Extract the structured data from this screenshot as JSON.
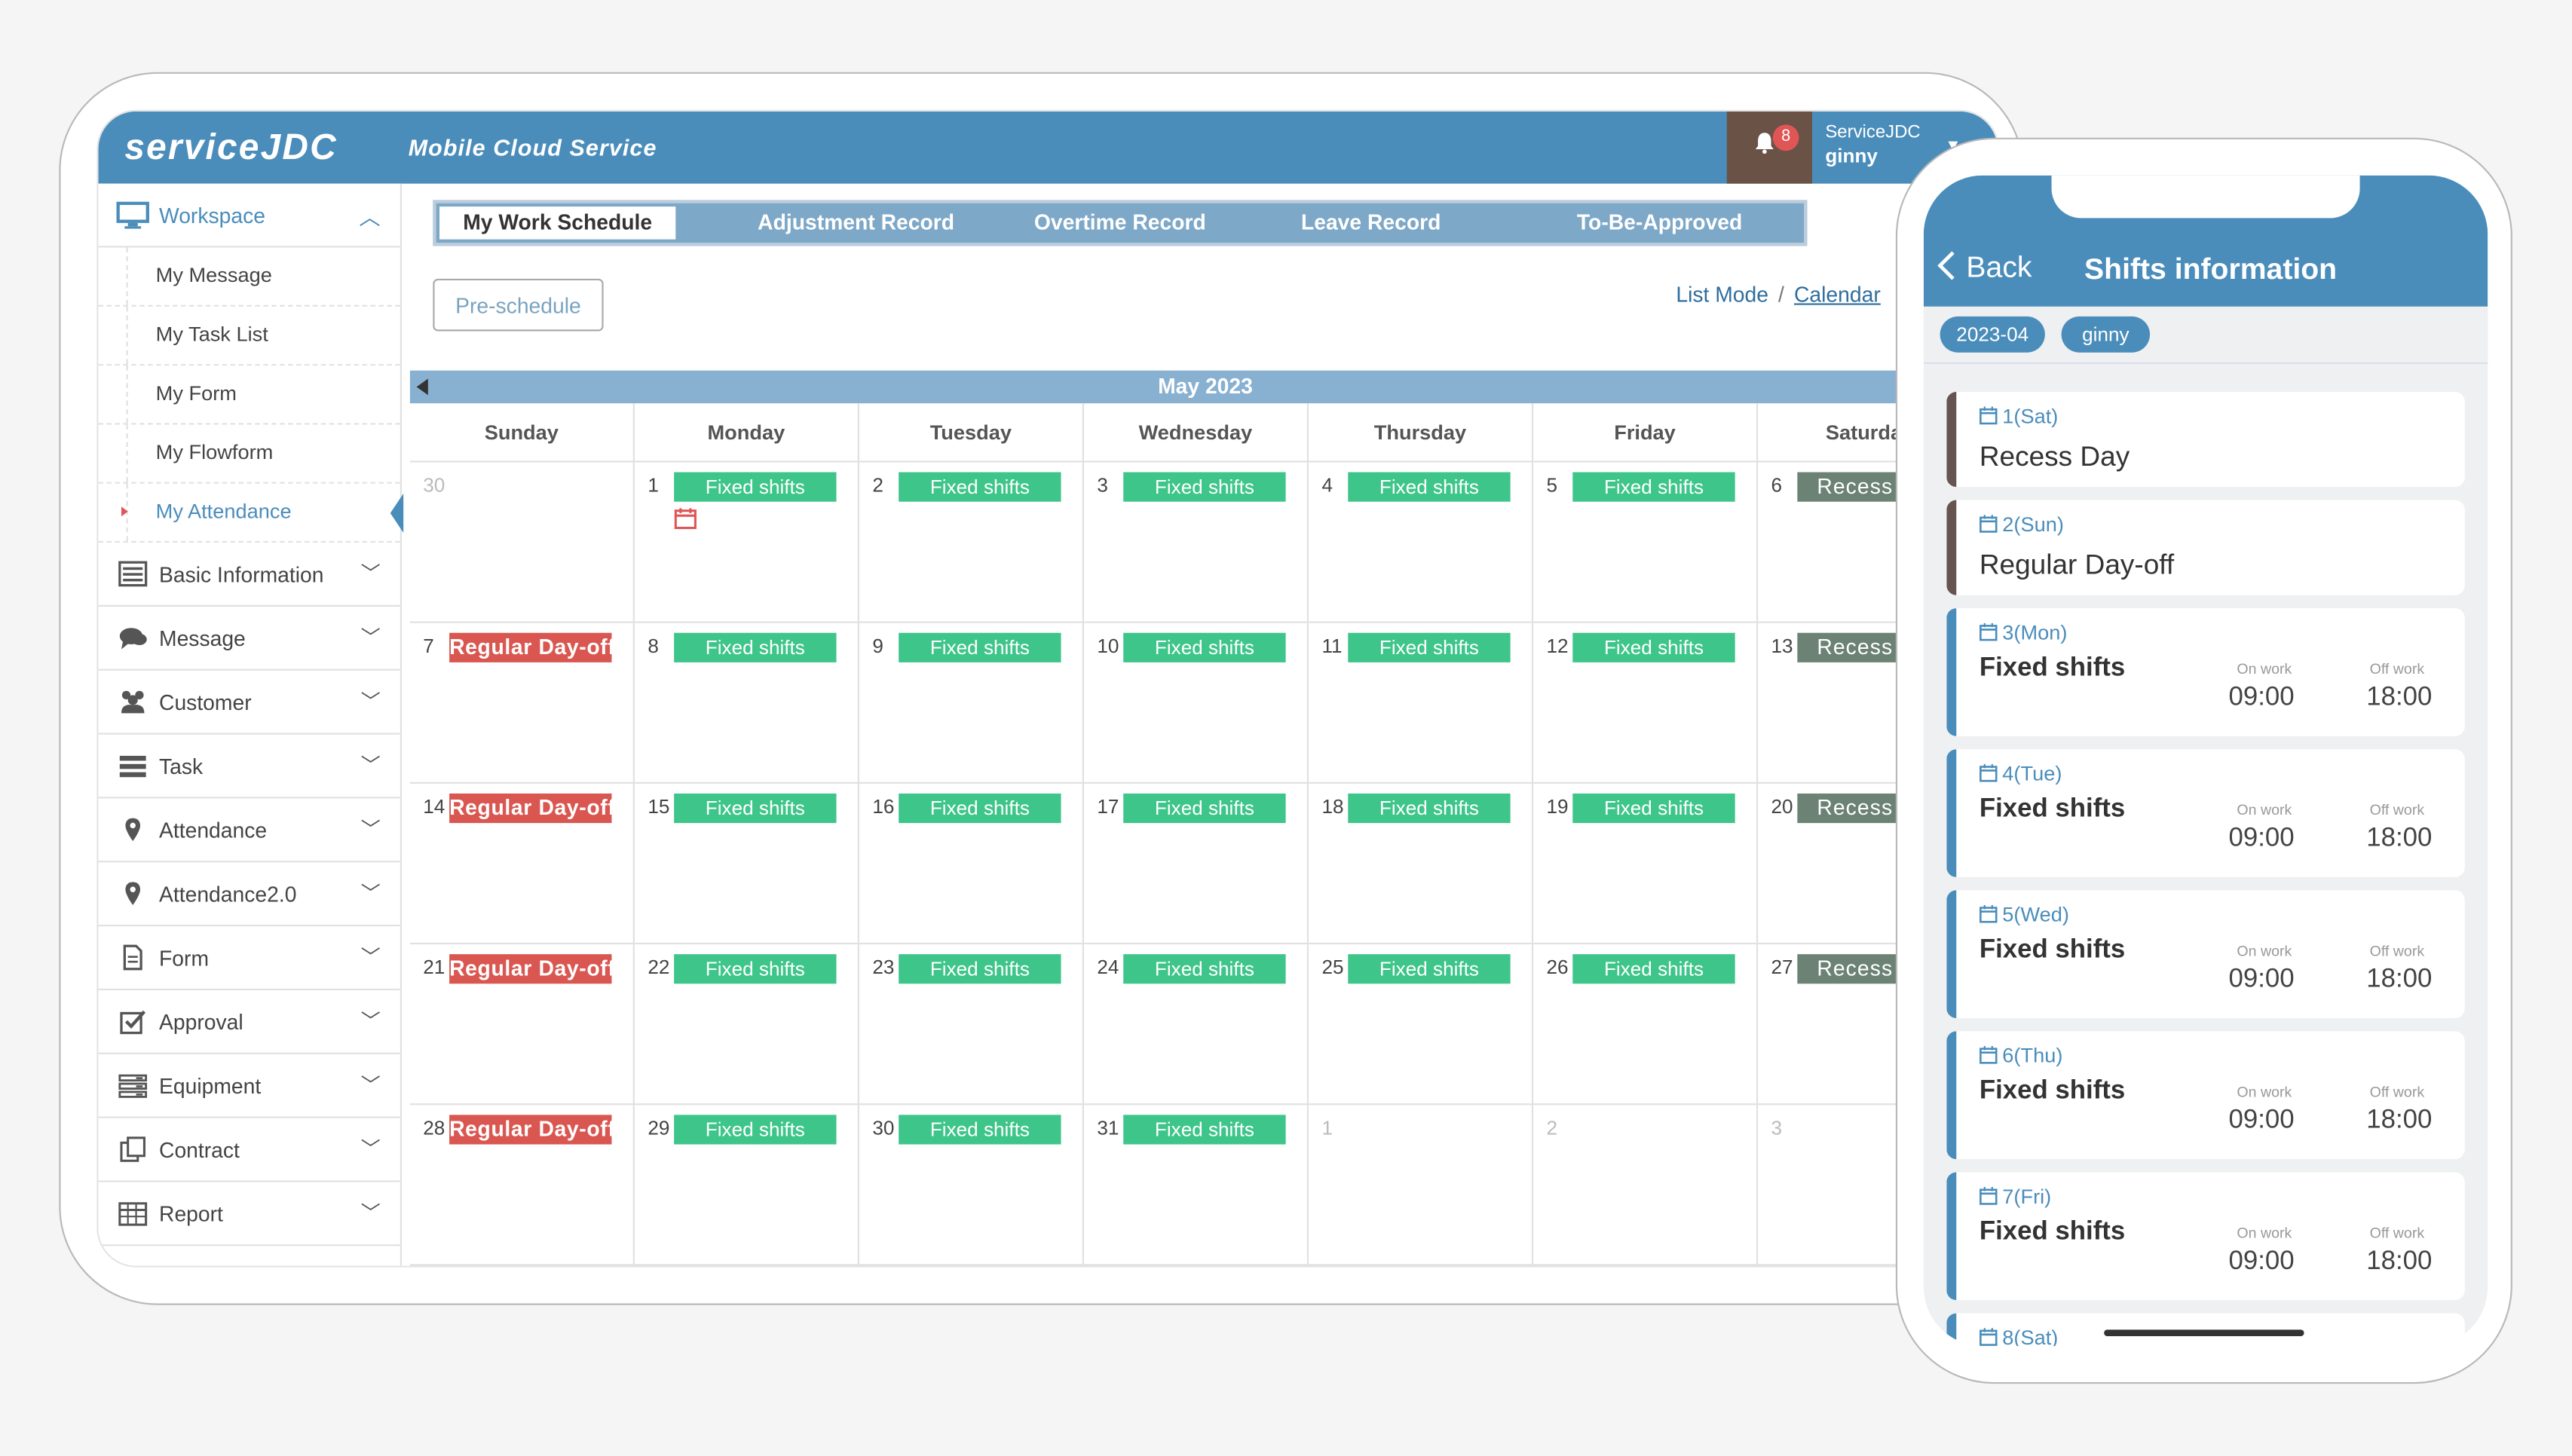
{
  "app": {
    "brand": "serviceJDC",
    "subtitle": "Mobile Cloud Service",
    "notification_count": "8",
    "user_company": "ServiceJDC",
    "user_name": "ginny"
  },
  "sidebar": {
    "workspace": "Workspace",
    "sub_items": [
      "My Message",
      "My Task List",
      "My Form",
      "My Flowform",
      "My Attendance"
    ],
    "items": [
      {
        "label": "Basic Information",
        "icon": "list-icon"
      },
      {
        "label": "Message",
        "icon": "chat-icon"
      },
      {
        "label": "Customer",
        "icon": "people-icon"
      },
      {
        "label": "Task",
        "icon": "task-icon"
      },
      {
        "label": "Attendance",
        "icon": "location-pin-icon"
      },
      {
        "label": "Attendance2.0",
        "icon": "location-pin-icon"
      },
      {
        "label": "Form",
        "icon": "document-icon"
      },
      {
        "label": "Approval",
        "icon": "checkbox-icon"
      },
      {
        "label": "Equipment",
        "icon": "equipment-icon"
      },
      {
        "label": "Contract",
        "icon": "contract-icon"
      },
      {
        "label": "Report",
        "icon": "table-icon"
      }
    ]
  },
  "tabs": [
    "My Work Schedule",
    "Adjustment Record",
    "Overtime Record",
    "Leave Record",
    "To-Be-Approved"
  ],
  "preschedule": "Pre-schedule",
  "modes": {
    "list": "List Mode",
    "separator": "/",
    "calendar": "Calendar"
  },
  "calendar": {
    "month": "May 2023",
    "days": [
      "Sunday",
      "Monday",
      "Tuesday",
      "Wednesday",
      "Thursday",
      "Friday",
      "Saturday"
    ],
    "weeks": [
      [
        {
          "n": "30",
          "dim": true,
          "t": ""
        },
        {
          "n": "1",
          "t": "Fixed shifts",
          "k": "fixed",
          "icon": true
        },
        {
          "n": "2",
          "t": "Fixed shifts",
          "k": "fixed"
        },
        {
          "n": "3",
          "t": "Fixed shifts",
          "k": "fixed"
        },
        {
          "n": "4",
          "t": "Fixed shifts",
          "k": "fixed"
        },
        {
          "n": "5",
          "t": "Fixed shifts",
          "k": "fixed"
        },
        {
          "n": "6",
          "t": "Recess Day",
          "k": "recess"
        }
      ],
      [
        {
          "n": "7",
          "t": "Regular Day-off",
          "k": "off"
        },
        {
          "n": "8",
          "t": "Fixed shifts",
          "k": "fixed"
        },
        {
          "n": "9",
          "t": "Fixed shifts",
          "k": "fixed"
        },
        {
          "n": "10",
          "t": "Fixed shifts",
          "k": "fixed"
        },
        {
          "n": "11",
          "t": "Fixed shifts",
          "k": "fixed"
        },
        {
          "n": "12",
          "t": "Fixed shifts",
          "k": "fixed"
        },
        {
          "n": "13",
          "t": "Recess Day",
          "k": "recess"
        }
      ],
      [
        {
          "n": "14",
          "t": "Regular Day-off",
          "k": "off"
        },
        {
          "n": "15",
          "t": "Fixed shifts",
          "k": "fixed"
        },
        {
          "n": "16",
          "t": "Fixed shifts",
          "k": "fixed"
        },
        {
          "n": "17",
          "t": "Fixed shifts",
          "k": "fixed"
        },
        {
          "n": "18",
          "t": "Fixed shifts",
          "k": "fixed"
        },
        {
          "n": "19",
          "t": "Fixed shifts",
          "k": "fixed"
        },
        {
          "n": "20",
          "t": "Recess Day",
          "k": "recess"
        }
      ],
      [
        {
          "n": "21",
          "t": "Regular Day-off",
          "k": "off"
        },
        {
          "n": "22",
          "t": "Fixed shifts",
          "k": "fixed"
        },
        {
          "n": "23",
          "t": "Fixed shifts",
          "k": "fixed"
        },
        {
          "n": "24",
          "t": "Fixed shifts",
          "k": "fixed"
        },
        {
          "n": "25",
          "t": "Fixed shifts",
          "k": "fixed"
        },
        {
          "n": "26",
          "t": "Fixed shifts",
          "k": "fixed"
        },
        {
          "n": "27",
          "t": "Recess Day",
          "k": "recess"
        }
      ],
      [
        {
          "n": "28",
          "t": "Regular Day-off",
          "k": "off"
        },
        {
          "n": "29",
          "t": "Fixed shifts",
          "k": "fixed"
        },
        {
          "n": "30",
          "t": "Fixed shifts",
          "k": "fixed"
        },
        {
          "n": "31",
          "t": "Fixed shifts",
          "k": "fixed"
        },
        {
          "n": "1",
          "dim": true,
          "t": ""
        },
        {
          "n": "2",
          "dim": true,
          "t": ""
        },
        {
          "n": "3",
          "dim": true,
          "t": ""
        }
      ]
    ]
  },
  "phone": {
    "back": "Back",
    "title": "Shifts information",
    "month": "2023-04",
    "user": "ginny",
    "on_label": "On work",
    "off_label": "Off work",
    "cards": [
      {
        "date": "1(Sat)",
        "title": "Recess Day",
        "kind": "big"
      },
      {
        "date": "2(Sun)",
        "title": "Regular Day-off",
        "kind": "big"
      },
      {
        "date": "3(Mon)",
        "title": "Fixed shifts",
        "kind": "shift",
        "on": "09:00",
        "off": "18:00"
      },
      {
        "date": "4(Tue)",
        "title": "Fixed shifts",
        "kind": "shift",
        "on": "09:00",
        "off": "18:00"
      },
      {
        "date": "5(Wed)",
        "title": "Fixed shifts",
        "kind": "shift",
        "on": "09:00",
        "off": "18:00"
      },
      {
        "date": "6(Thu)",
        "title": "Fixed shifts",
        "kind": "shift",
        "on": "09:00",
        "off": "18:00"
      },
      {
        "date": "7(Fri)",
        "title": "Fixed shifts",
        "kind": "shift",
        "on": "09:00",
        "off": "18:00"
      },
      {
        "date": "8(Sat)",
        "title": "",
        "kind": "partial"
      }
    ]
  }
}
